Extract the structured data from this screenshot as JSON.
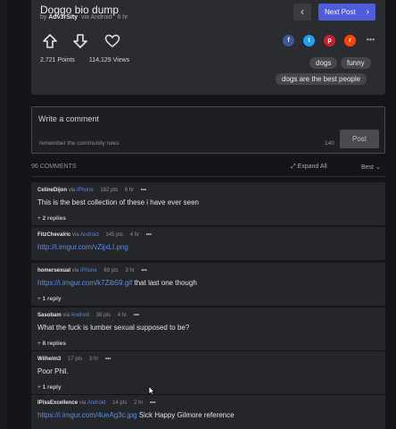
{
  "post": {
    "title": "Doggo bio dump",
    "by": "by",
    "author": "Adv3rSity",
    "via_prefix": "via",
    "via": "Android",
    "age": "6 hr",
    "prev_label": "‹",
    "next_label": "Next Post",
    "points": "2,721 Points",
    "views": "114,129 Views",
    "tags": [
      "dogs",
      "funny",
      "dogs are the best people"
    ]
  },
  "comment_form": {
    "placeholder": "Write a comment",
    "rules": "remember the community rules",
    "char_count": "140",
    "post_label": "Post"
  },
  "comments_header": {
    "count": "96 COMMENTS",
    "expand_all": "Expand All",
    "sort": "Best"
  },
  "comments": [
    {
      "user": "CelineDijon",
      "via": "via",
      "source": "iPhone",
      "points": "182 pts",
      "age": "6 hr",
      "text": "This is the best collection of these i have ever seen",
      "link": "",
      "replies_count": "2",
      "replies_word": "replies"
    },
    {
      "user": "FitzChevalric",
      "via": "via",
      "source": "Android",
      "points": "145 pts",
      "age": "4 hr",
      "text": "",
      "link": "http://i.imgur.com/vZijxLI.png",
      "replies_count": "",
      "replies_word": ""
    },
    {
      "user": "homersexual",
      "via": "via",
      "source": "iPhone",
      "points": "69 pts",
      "age": "3 hr",
      "text": "that last one though",
      "link": "https://i.imgur.com/k7Zib59.gif",
      "replies_count": "1",
      "replies_word": "reply"
    },
    {
      "user": "Sasobam",
      "via": "via",
      "source": "Android",
      "points": "38 pts",
      "age": "4 hr",
      "text": "What the fuck is lumber sexual supposed to be?",
      "link": "",
      "replies_count": "8",
      "replies_word": "replies"
    },
    {
      "user": "Wilhelm3",
      "via": "",
      "source": "",
      "points": "17 pts",
      "age": "3 hr",
      "text": "Poor Phil.",
      "link": "",
      "replies_count": "1",
      "replies_word": "reply"
    },
    {
      "user": "IPissExcellence",
      "via": "via",
      "source": "Android",
      "points": "14 pts",
      "age": "2 hr",
      "text": "Sick Happy Gilmore reference",
      "link": "https://i.imgur.com/4ueAg3c.jpg",
      "replies_count": "",
      "replies_word": ""
    }
  ],
  "icons": {
    "upvote": "upvote-icon",
    "downvote": "downvote-icon",
    "favorite": "heart-icon",
    "facebook": "facebook-icon",
    "twitter": "twitter-icon",
    "pinterest": "pinterest-icon",
    "reddit": "reddit-icon"
  },
  "colors": {
    "accent": "#4f5cdc",
    "link": "#5a90e0",
    "background": "#141518",
    "panel": "#2b2c30"
  }
}
